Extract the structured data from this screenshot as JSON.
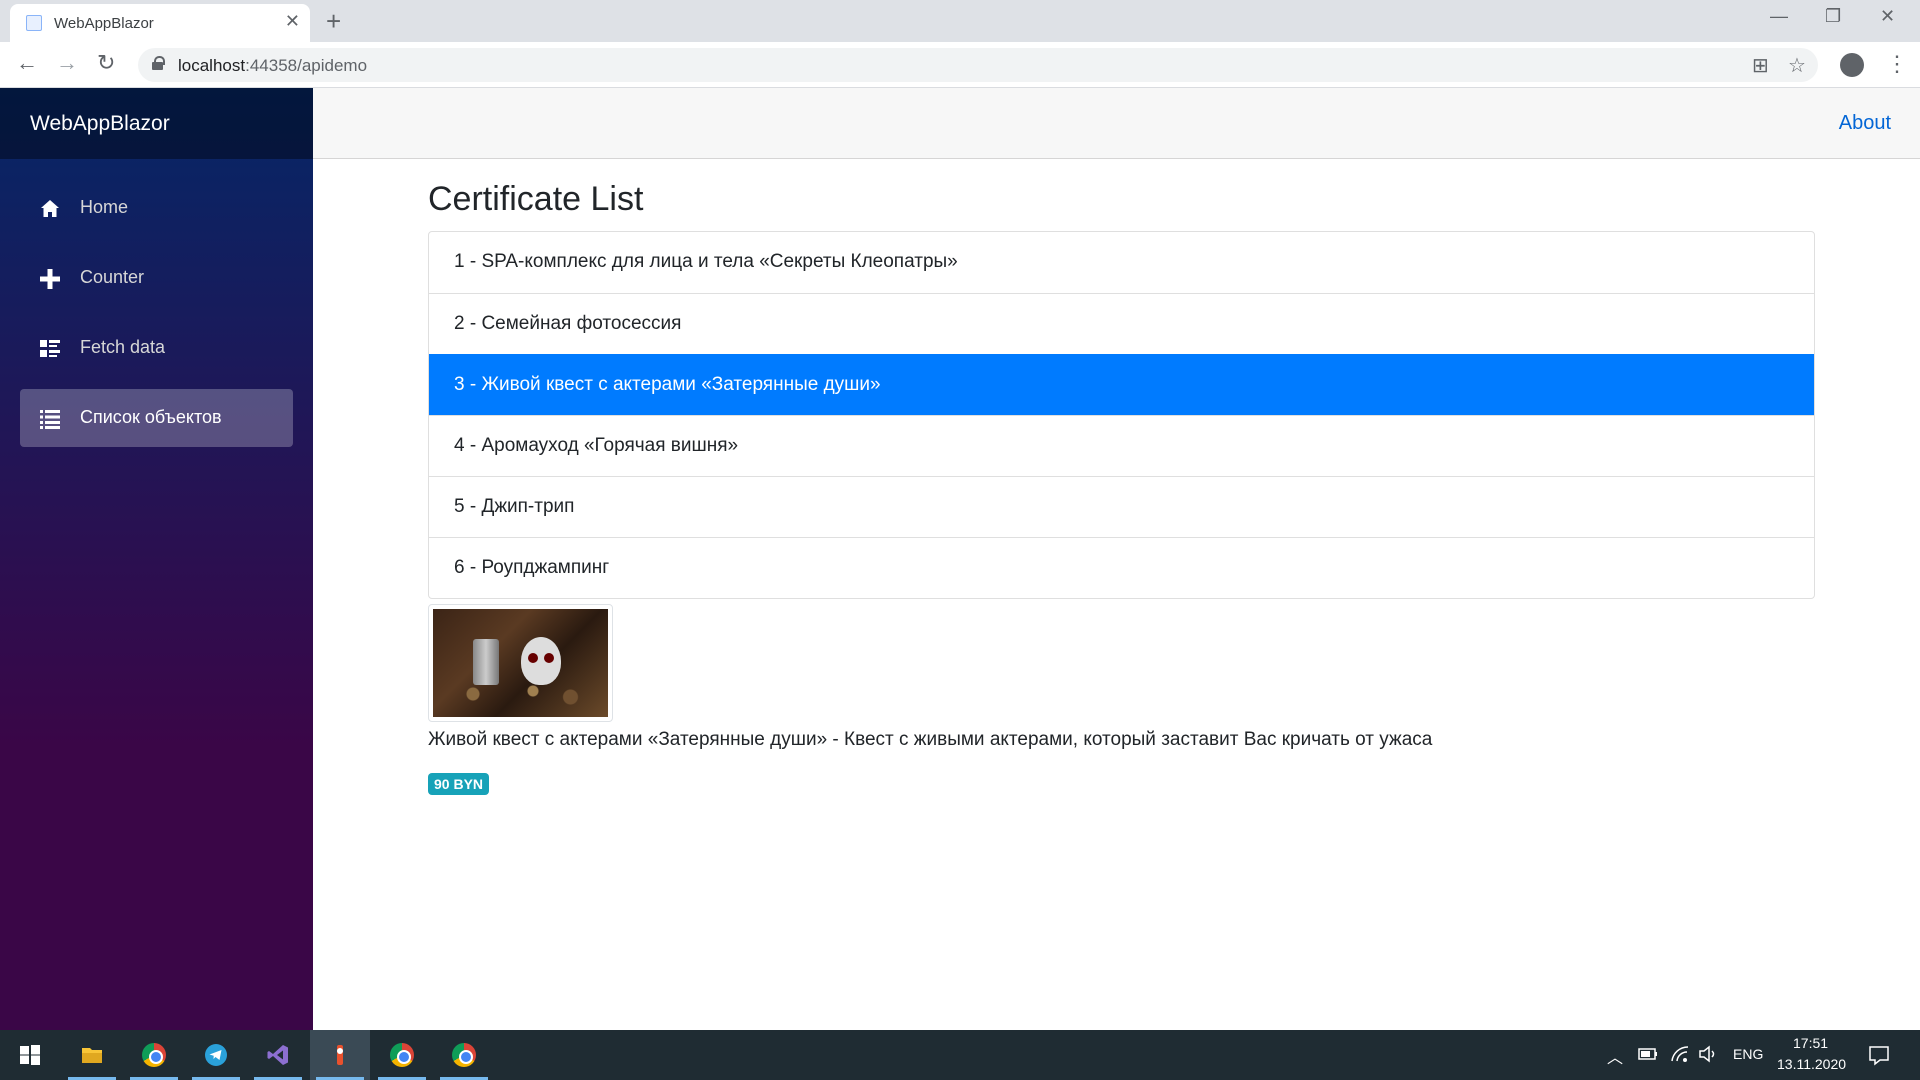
{
  "browser": {
    "tab_title": "WebAppBlazor",
    "tab_close": "✕",
    "new_tab": "+",
    "url_host": "localhost",
    "url_rest": ":44358/apidemo",
    "back": "←",
    "forward": "→",
    "reload": "↻",
    "translate_icon": "⊞",
    "star_icon": "☆",
    "menu_icon": "⋮",
    "minimize": "—",
    "maximize": "❐",
    "close": "✕"
  },
  "sidebar": {
    "brand": "WebAppBlazor",
    "items": [
      {
        "label": "Home",
        "icon": "home-icon",
        "active": false
      },
      {
        "label": "Counter",
        "icon": "plus-icon",
        "active": false
      },
      {
        "label": "Fetch data",
        "icon": "list-rich-icon",
        "active": false
      },
      {
        "label": "Список объектов",
        "icon": "list-icon",
        "active": true
      }
    ]
  },
  "top_row": {
    "about": "About"
  },
  "main": {
    "title": "Certificate List",
    "items": [
      "1 - SPA-комплекс для лица и тела «Секреты Клеопатры»",
      "2 - Семейная фотосессия",
      "3 - Живой квест с актерами «Затерянные души»",
      "4 - Аромауход «Горячая вишня»",
      "5 - Джип-трип",
      "6 - Роупджампинг"
    ],
    "selected_index": 2,
    "description": "Живой квест с актерами «Затерянные души» - Квест с живыми актерами, который заставит Вас кричать от ужаса",
    "price": "90 BYN"
  },
  "taskbar": {
    "apps": [
      "windows-start",
      "file-explorer",
      "chrome",
      "telegram",
      "visual-studio",
      "app",
      "chrome",
      "chrome"
    ],
    "language": "ENG",
    "time": "17:51",
    "date": "13.11.2020"
  },
  "colors": {
    "accent": "#007bff",
    "badge": "#17a2b8",
    "link": "#0366d6"
  }
}
